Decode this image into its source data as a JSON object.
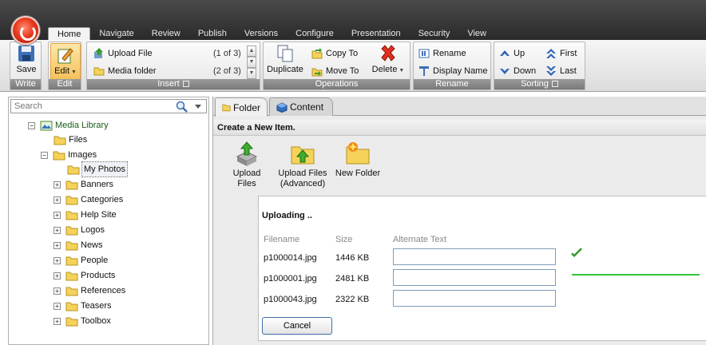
{
  "ribbon_tabs": [
    "Home",
    "Navigate",
    "Review",
    "Publish",
    "Versions",
    "Configure",
    "Presentation",
    "Security",
    "View"
  ],
  "active_tab": "Home",
  "groups": {
    "write": {
      "label": "Write",
      "save": "Save"
    },
    "edit": {
      "label": "Edit",
      "edit": "Edit"
    },
    "insert": {
      "label": "Insert",
      "upload_file": "Upload File",
      "upload_count": "(1 of 3)",
      "media_folder": "Media folder",
      "media_count": "(2 of 3)"
    },
    "operations": {
      "label": "Operations",
      "duplicate": "Duplicate",
      "copy_to": "Copy To",
      "move_to": "Move To",
      "delete": "Delete"
    },
    "rename": {
      "label": "Rename",
      "rename": "Rename",
      "display_name": "Display Name"
    },
    "sorting": {
      "label": "Sorting",
      "up": "Up",
      "down": "Down",
      "first": "First",
      "last": "Last"
    }
  },
  "search": {
    "placeholder": "Search"
  },
  "tree": {
    "root": "Media Library",
    "files": "Files",
    "images": "Images",
    "children": [
      "My Photos",
      "Banners",
      "Categories",
      "Help Site",
      "Logos",
      "News",
      "People",
      "Products",
      "References",
      "Teasers",
      "Toolbox"
    ]
  },
  "content_tabs": [
    "Folder",
    "Content"
  ],
  "create_title": "Create a New Item.",
  "actions": [
    {
      "label_1": "Upload Files",
      "label_2": ""
    },
    {
      "label_1": "Upload Files",
      "label_2": "(Advanced)"
    },
    {
      "label_1": "New Folder",
      "label_2": ""
    }
  ],
  "upload": {
    "title": "Uploading ..",
    "headers": {
      "filename": "Filename",
      "size": "Size",
      "alt": "Alternate Text"
    },
    "rows": [
      {
        "filename": "p1000014.jpg",
        "size": "1446 KB",
        "alt": ""
      },
      {
        "filename": "p1000001.jpg",
        "size": "2481 KB",
        "alt": ""
      },
      {
        "filename": "p1000043.jpg",
        "size": "2322 KB",
        "alt": ""
      }
    ],
    "cancel": "Cancel"
  },
  "colors": {
    "accent_orange": "#f0a030",
    "progress_green": "#34c234",
    "folder_yellow": "#f5d35a"
  }
}
